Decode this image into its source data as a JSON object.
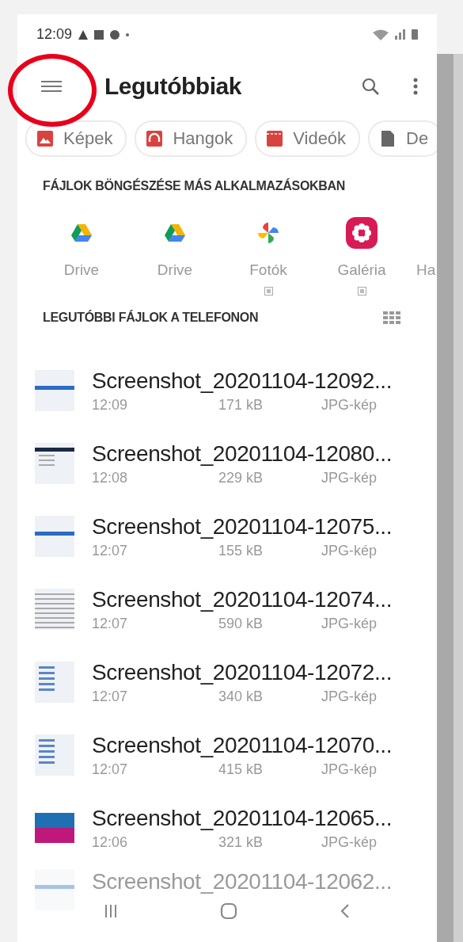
{
  "status_bar": {
    "time": "12:09"
  },
  "header": {
    "title": "Legutóbbiak"
  },
  "chips": [
    {
      "label": "Képek",
      "kind": "images"
    },
    {
      "label": "Hangok",
      "kind": "audio"
    },
    {
      "label": "Videók",
      "kind": "video"
    },
    {
      "label": "De",
      "kind": "document"
    }
  ],
  "apps_section": {
    "heading": "FÁJLOK BÖNGÉSZÉSE MÁS ALKALMAZÁSOKBAN"
  },
  "apps": [
    {
      "label": "Drive",
      "kind": "drive",
      "badge": false
    },
    {
      "label": "Drive",
      "kind": "drive",
      "badge": false
    },
    {
      "label": "Fotók",
      "kind": "photos",
      "badge": true
    },
    {
      "label": "Galéria",
      "kind": "gallery",
      "badge": true
    },
    {
      "label": "Ha",
      "kind": "hidden",
      "badge": false
    }
  ],
  "recent_section": {
    "heading": "LEGUTÓBBI FÁJLOK A TELEFONON"
  },
  "files": [
    {
      "name": "Screenshot_20201104-12092...",
      "time": "12:09",
      "size": "171 kB",
      "type": "JPG-kép",
      "kind": "banner"
    },
    {
      "name": "Screenshot_20201104-12080...",
      "time": "12:08",
      "size": "229 kB",
      "type": "JPG-kép",
      "kind": "dark"
    },
    {
      "name": "Screenshot_20201104-12075...",
      "time": "12:07",
      "size": "155 kB",
      "type": "JPG-kép",
      "kind": "banner"
    },
    {
      "name": "Screenshot_20201104-12074...",
      "time": "12:07",
      "size": "590 kB",
      "type": "JPG-kép",
      "kind": "doc"
    },
    {
      "name": "Screenshot_20201104-12072...",
      "time": "12:07",
      "size": "340 kB",
      "type": "JPG-kép",
      "kind": "list"
    },
    {
      "name": "Screenshot_20201104-12070...",
      "time": "12:07",
      "size": "415 kB",
      "type": "JPG-kép",
      "kind": "list"
    },
    {
      "name": "Screenshot_20201104-12065...",
      "time": "12:06",
      "size": "321 kB",
      "type": "JPG-kép",
      "kind": "magenta"
    }
  ],
  "faded_file": {
    "name": "Screenshot_20201104-12062..."
  }
}
